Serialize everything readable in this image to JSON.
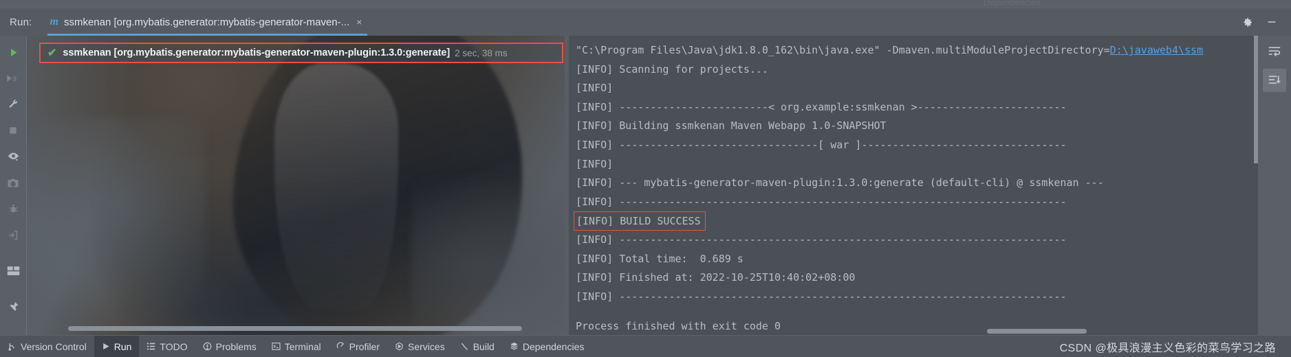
{
  "window": {
    "ghost_tab_above": "Dependencies",
    "gear_icon": "gear-icon",
    "minimize_icon": "minimize-icon"
  },
  "run_header": {
    "label": "Run:",
    "maven_icon": "maven-icon",
    "tab_title": "ssmkenan [org.mybatis.generator:mybatis-generator-maven-...",
    "close_icon": "×"
  },
  "left_rail": {
    "items": [
      {
        "name": "run-icon",
        "glyph": "▶"
      },
      {
        "name": "rerun-failed-tests-icon",
        "glyph": "▶9"
      },
      {
        "name": "settings-wrench-icon",
        "glyph": "wrench"
      },
      {
        "name": "stop-icon",
        "glyph": "■"
      },
      {
        "name": "eye-filter-icon",
        "glyph": "eye"
      },
      {
        "name": "camera-screenshot-icon",
        "glyph": "camera"
      },
      {
        "name": "debug-bug-icon",
        "glyph": "bug"
      },
      {
        "name": "export-icon",
        "glyph": "export"
      },
      {
        "name": "layout-icon",
        "glyph": "layout"
      },
      {
        "name": "pin-icon",
        "glyph": "pin"
      }
    ]
  },
  "tree": {
    "check_icon": "check-icon",
    "node_title": "ssmkenan [org.mybatis.generator:mybatis-generator-maven-plugin:1.3.0:generate]",
    "node_time": "2 sec, 38 ms",
    "annotation_color": "#e8504a"
  },
  "console": {
    "lines": [
      {
        "text": "\"C:\\Program Files\\Java\\jdk1.8.0_162\\bin\\java.exe\" -Dmaven.multiModuleProjectDirectory=",
        "link": "D:\\javaweb4\\ssm",
        "boxed": false
      },
      {
        "text": "[INFO] Scanning for projects...",
        "boxed": false
      },
      {
        "text": "[INFO]",
        "boxed": false
      },
      {
        "text": "[INFO] ------------------------< org.example:ssmkenan >------------------------",
        "boxed": false
      },
      {
        "text": "[INFO] Building ssmkenan Maven Webapp 1.0-SNAPSHOT",
        "boxed": false
      },
      {
        "text": "[INFO] --------------------------------[ war ]---------------------------------",
        "boxed": false
      },
      {
        "text": "[INFO]",
        "boxed": false
      },
      {
        "text": "[INFO] --- mybatis-generator-maven-plugin:1.3.0:generate (default-cli) @ ssmkenan ---",
        "boxed": false
      },
      {
        "text": "[INFO] ------------------------------------------------------------------------",
        "boxed": false
      },
      {
        "text": "[INFO] BUILD SUCCESS",
        "boxed": true
      },
      {
        "text": "[INFO] ------------------------------------------------------------------------",
        "boxed": false
      },
      {
        "text": "[INFO] Total time:  0.689 s",
        "boxed": false
      },
      {
        "text": "[INFO] Finished at: 2022-10-25T10:40:02+08:00",
        "boxed": false
      },
      {
        "text": "[INFO] ------------------------------------------------------------------------",
        "boxed": false
      }
    ],
    "final_line": "Process finished with exit code 0"
  },
  "right_rail": {
    "items": [
      {
        "name": "soft-wrap-icon",
        "glyph": "wrap"
      },
      {
        "name": "scroll-to-end-icon",
        "glyph": "scroll-end"
      }
    ]
  },
  "status_bar": {
    "items": [
      {
        "name": "status-item-version-control",
        "label": "Version Control",
        "icon": "branch-icon",
        "selected": false
      },
      {
        "name": "status-item-run",
        "label": "Run",
        "icon": "play-icon",
        "selected": true
      },
      {
        "name": "status-item-todo",
        "label": "TODO",
        "icon": "list-icon",
        "selected": false
      },
      {
        "name": "status-item-problems",
        "label": "Problems",
        "icon": "warning-icon",
        "selected": false
      },
      {
        "name": "status-item-terminal",
        "label": "Terminal",
        "icon": "terminal-icon",
        "selected": false
      },
      {
        "name": "status-item-profiler",
        "label": "Profiler",
        "icon": "profiler-icon",
        "selected": false
      },
      {
        "name": "status-item-services",
        "label": "Services",
        "icon": "services-icon",
        "selected": false
      },
      {
        "name": "status-item-build",
        "label": "Build",
        "icon": "hammer-icon",
        "selected": false
      },
      {
        "name": "status-item-dependencies",
        "label": "Dependencies",
        "icon": "layers-icon",
        "selected": false
      }
    ],
    "watermark": "CSDN @极具浪漫主义色彩的菜鸟学习之路"
  }
}
